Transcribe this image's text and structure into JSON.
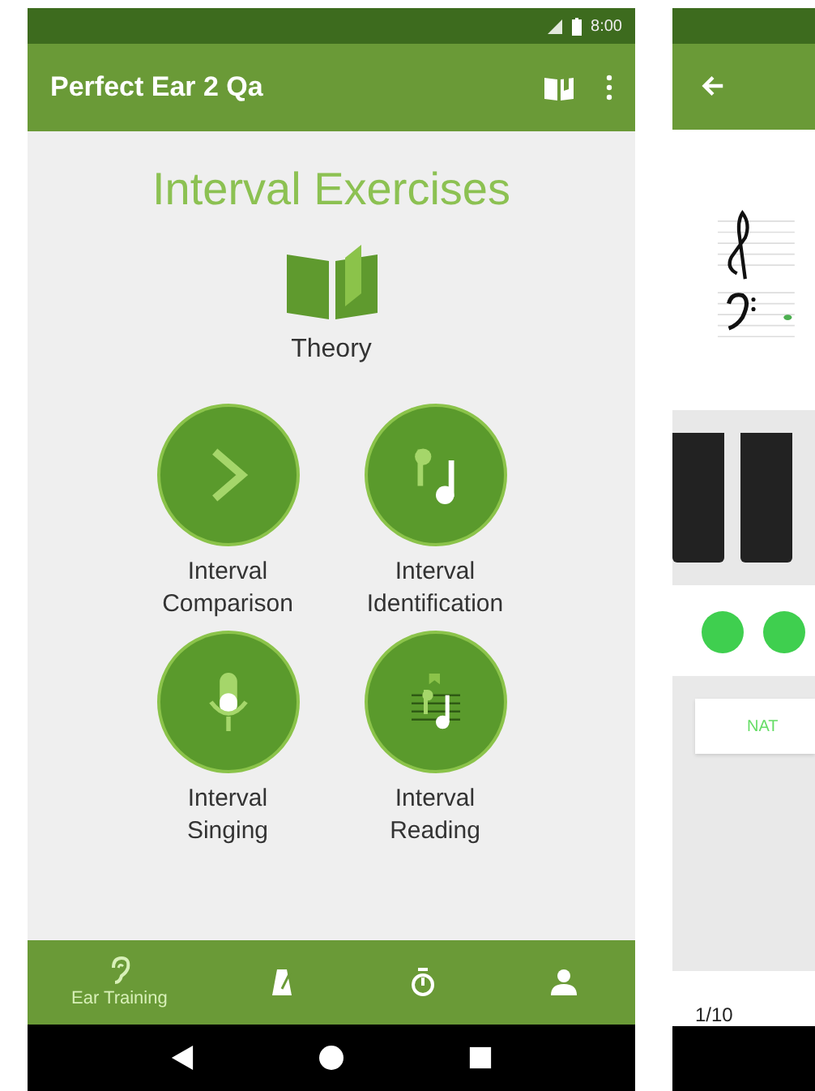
{
  "status_bar": {
    "time": "8:00"
  },
  "app_bar": {
    "title": "Perfect Ear 2 Qa"
  },
  "heading": "Interval Exercises",
  "theory": {
    "label": "Theory"
  },
  "exercises": [
    {
      "label": "Interval Comparison"
    },
    {
      "label": "Interval Identification"
    },
    {
      "label": "Interval Singing"
    },
    {
      "label": "Interval Reading"
    }
  ],
  "bottom_nav": [
    {
      "label": "Ear Training",
      "selected": true
    },
    {
      "selected": false
    },
    {
      "selected": false
    },
    {
      "selected": false
    }
  ],
  "second_screen": {
    "answer_button": "NAT",
    "counter": "1/10"
  }
}
